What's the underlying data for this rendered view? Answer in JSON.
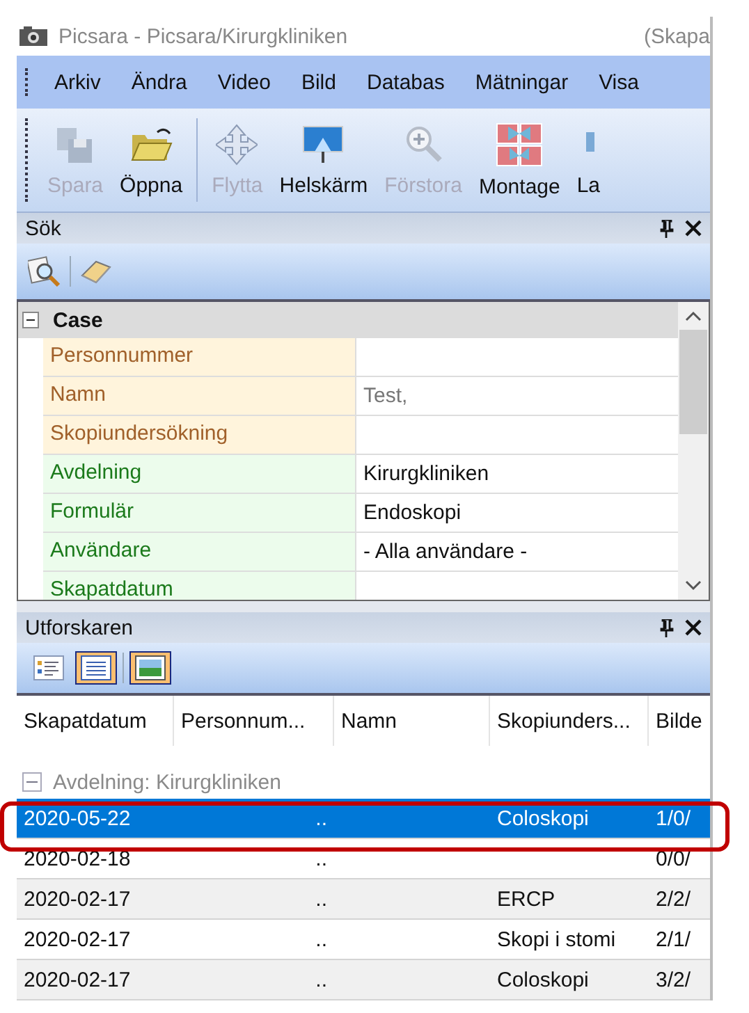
{
  "title_bar": {
    "title": "Picsara - Picsara/Kirurgkliniken",
    "title_end": "(Skapa"
  },
  "menu": [
    "Arkiv",
    "Ändra",
    "Video",
    "Bild",
    "Databas",
    "Mätningar",
    "Visa"
  ],
  "toolbar": [
    [
      {
        "label": "Spara",
        "kind": "save",
        "disabled": true
      },
      {
        "label": "Öppna",
        "kind": "open",
        "disabled": false
      }
    ],
    [
      {
        "label": "Flytta",
        "kind": "move",
        "disabled": true
      },
      {
        "label": "Helskärm",
        "kind": "fullscreen",
        "disabled": false
      },
      {
        "label": "Förstora",
        "kind": "zoom",
        "disabled": true
      },
      {
        "label": "Montage",
        "kind": "montage",
        "disabled": false
      },
      {
        "label": "La",
        "kind": "other",
        "disabled": false
      }
    ]
  ],
  "search_panel": {
    "title": "Sök",
    "category": {
      "label": "Case",
      "expanded": true
    },
    "properties": [
      {
        "name": "Personnummer",
        "kind": "patient"
      },
      {
        "name": "Namn",
        "value": "Test,",
        "kind": "patient",
        "dimmed": true
      },
      {
        "name": "Skopiundersökning",
        "kind": "patient"
      },
      {
        "name": "Avdelning",
        "value": "Kirurgkliniken",
        "kind": "filter",
        "dimmed": false
      },
      {
        "name": "Formulär",
        "value": "Endoskopi",
        "kind": "filter",
        "dimmed": false
      },
      {
        "name": "Användare",
        "value": "- Alla användare -",
        "kind": "filter",
        "dimmed": false
      },
      {
        "name": "Skapatdatum",
        "kind": "filter"
      }
    ]
  },
  "explorer": {
    "title": "Utforskaren",
    "view_buttons": [
      {
        "kind": "details",
        "selected": false
      },
      {
        "kind": "list",
        "selected": true
      },
      {
        "kind": "thumbnails",
        "selected": true
      }
    ],
    "columns": [
      "Skapatdatum",
      "Personnum...",
      "Namn",
      "Skopiunders...",
      "Bilde"
    ],
    "group": {
      "label": "Avdelning: Kirurgkliniken",
      "expanded": true
    },
    "rows": [
      {
        "cells": [
          "2020-05-22",
          "..",
          "",
          "Coloskopi",
          "1/0/"
        ],
        "selected": true,
        "highlighted": true
      },
      {
        "cells": [
          "2020-02-18",
          "..",
          "",
          "",
          "0/0/"
        ],
        "selected": false,
        "highlighted": false
      },
      {
        "cells": [
          "2020-02-17",
          "..",
          "",
          "ERCP",
          "2/2/"
        ],
        "selected": false,
        "highlighted": false
      },
      {
        "cells": [
          "2020-02-17",
          "..",
          "",
          "Skopi i stomi",
          "2/1/"
        ],
        "selected": false,
        "highlighted": false
      },
      {
        "cells": [
          "2020-02-17",
          "..",
          "",
          "Coloskopi",
          "3/2/"
        ],
        "selected": false,
        "highlighted": false
      }
    ]
  }
}
